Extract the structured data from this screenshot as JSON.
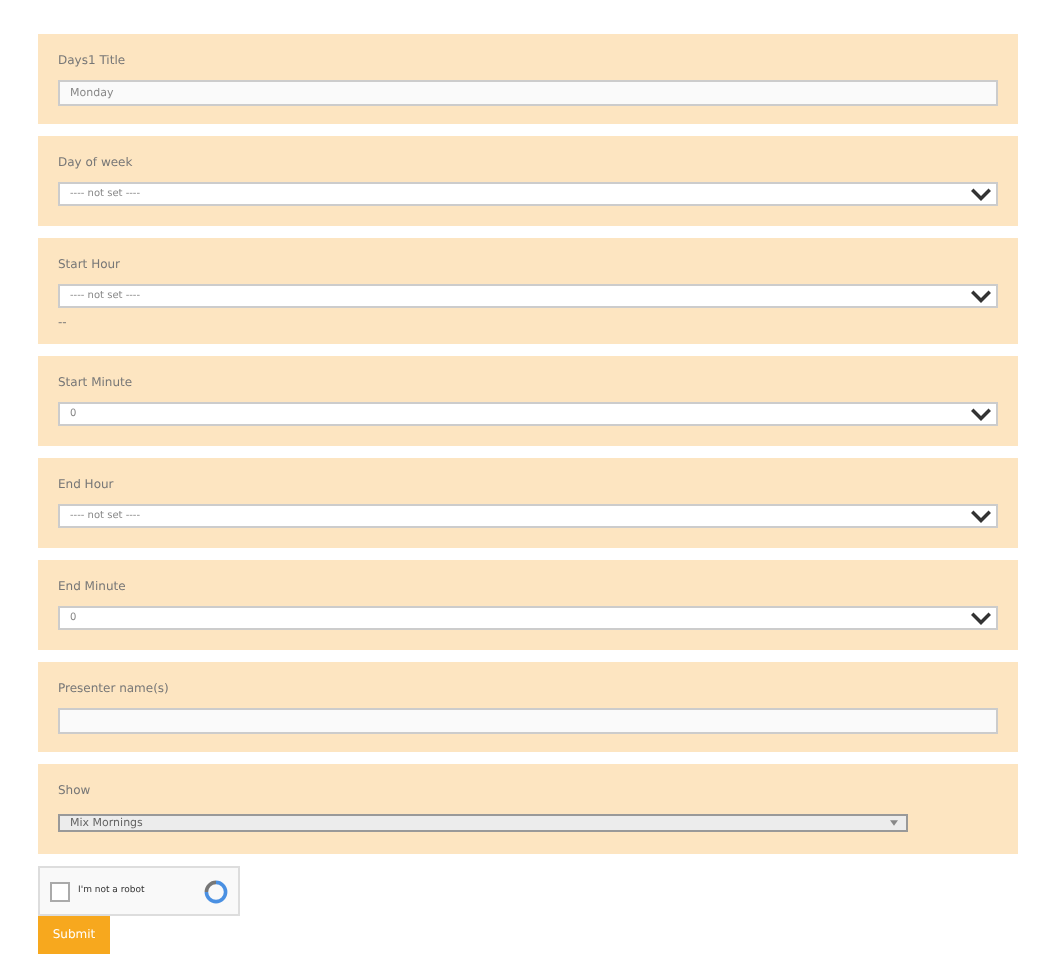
{
  "fields": [
    {
      "label": "Days1 Title",
      "kind": "text",
      "value": "Monday"
    },
    {
      "label": "Day of week",
      "kind": "select",
      "value": "---- not set ----"
    },
    {
      "label": "Start Hour",
      "kind": "select",
      "value": "---- not set ----",
      "note": "--"
    },
    {
      "label": "Start Minute",
      "kind": "select",
      "value": "0"
    },
    {
      "label": "End Hour",
      "kind": "select",
      "value": "---- not set ----"
    },
    {
      "label": "End Minute",
      "kind": "select",
      "value": "0"
    },
    {
      "label": "Presenter name(s)",
      "kind": "text"
    },
    {
      "label": "Show",
      "kind": "native-select",
      "value": "Mix Mornings"
    }
  ],
  "captcha": {
    "label": "I'm not a robot",
    "checked": false
  },
  "submit": "Submit"
}
